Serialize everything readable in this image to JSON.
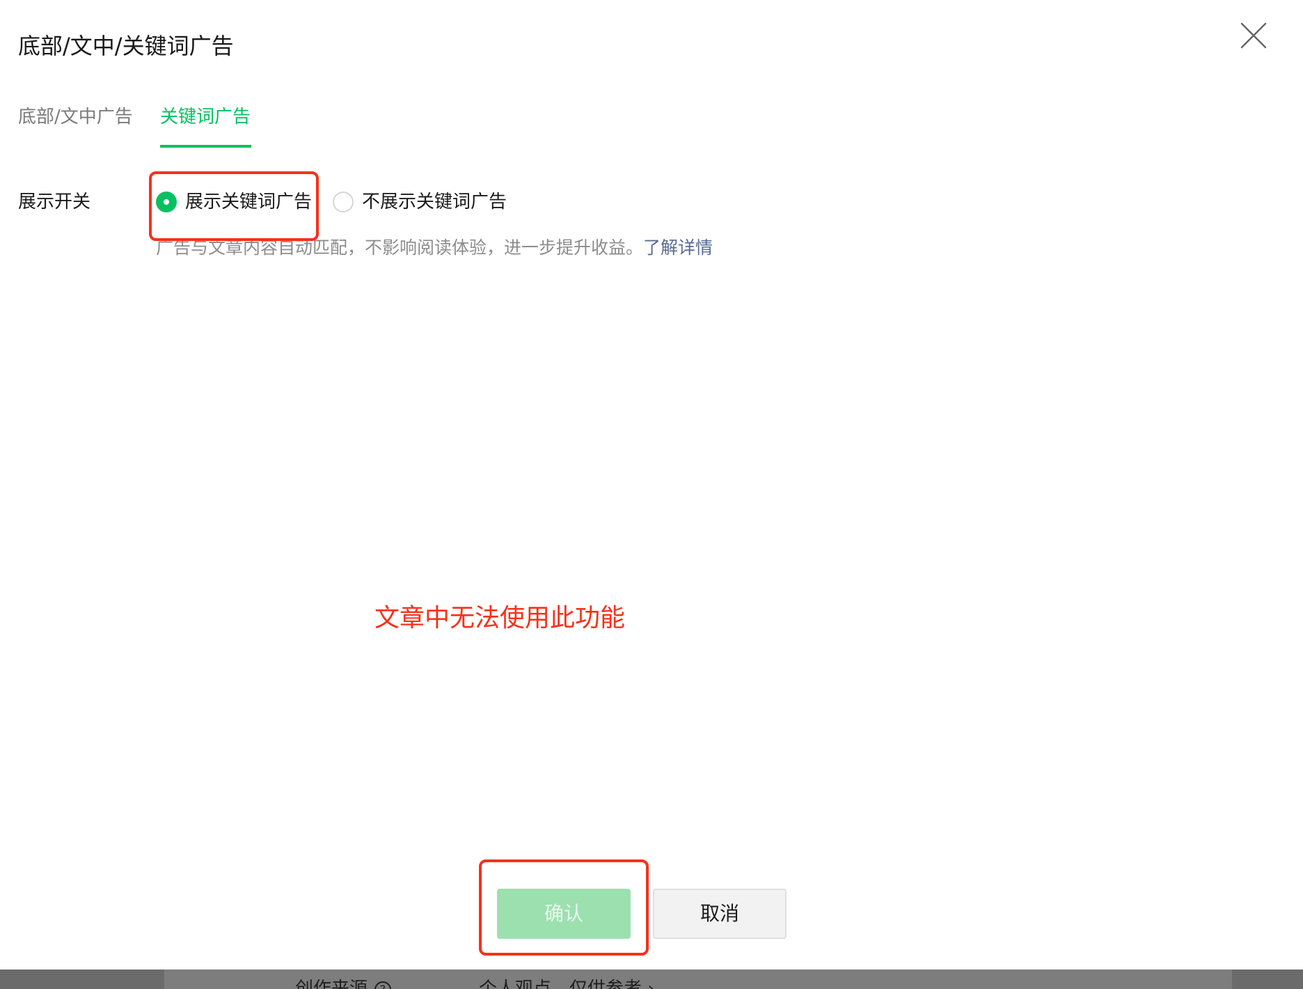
{
  "dialog": {
    "title": "底部/文中/关键词广告",
    "close_icon": "close-icon"
  },
  "tabs": [
    {
      "label": "底部/文中广告",
      "active": false
    },
    {
      "label": "关键词广告",
      "active": true
    }
  ],
  "display_switch": {
    "label": "展示开关",
    "options": [
      {
        "label": "展示关键词广告",
        "checked": true
      },
      {
        "label": "不展示关键词广告",
        "checked": false
      }
    ],
    "hint": "广告与文章内容自动匹配，不影响阅读体验，进一步提升收益。",
    "hint_link": "了解详情"
  },
  "annotation": {
    "note": "文章中无法使用此功能",
    "color": "#f5311b"
  },
  "footer": {
    "confirm_label": "确认",
    "cancel_label": "取消"
  },
  "underlay": {
    "field_label": "创作来源",
    "help_icon": "?",
    "field_value": "个人观点，仅供参考 ›"
  },
  "colors": {
    "accent": "#07c160",
    "link": "#576b95",
    "confirm_disabled": "#9ce0b0"
  }
}
